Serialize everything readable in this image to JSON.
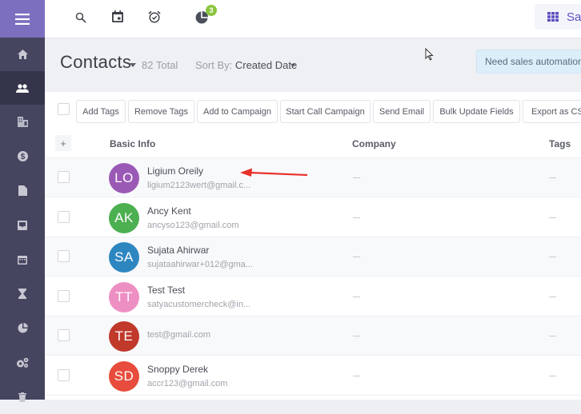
{
  "sidebar": {
    "menu_icon": "hamburger-menu-icon",
    "items": [
      {
        "name": "home",
        "icon": "home-icon",
        "active": false
      },
      {
        "name": "contacts",
        "icon": "contacts-icon",
        "active": true
      },
      {
        "name": "companies",
        "icon": "building-icon",
        "active": false
      },
      {
        "name": "deals",
        "icon": "dollar-icon",
        "active": false
      },
      {
        "name": "documents",
        "icon": "document-icon",
        "active": false
      },
      {
        "name": "inbox",
        "icon": "inbox-icon",
        "active": false
      },
      {
        "name": "calendar",
        "icon": "calendar-icon",
        "active": false
      },
      {
        "name": "tasks",
        "icon": "hourglass-icon",
        "active": false
      },
      {
        "name": "reports",
        "icon": "pie-chart-icon",
        "active": false
      },
      {
        "name": "settings",
        "icon": "gears-icon",
        "active": false
      },
      {
        "name": "trash",
        "icon": "trash-icon",
        "active": false
      }
    ]
  },
  "topbar": {
    "icons": [
      "search-icon",
      "calendar-icon",
      "alarm-clock-icon",
      "pie-chart-icon"
    ],
    "notification_badge": "3",
    "sales_button_label": "Sa"
  },
  "header": {
    "title": "Contacts",
    "total": "82 Total",
    "sort_label": "Sort By: ",
    "sort_value": "Created Date",
    "notice": "Need sales automation ?"
  },
  "toolbar": {
    "buttons": [
      "Add Tags",
      "Remove Tags",
      "Add to Campaign",
      "Start Call Campaign",
      "Send Email",
      "Bulk Update Fields",
      "Export as CSV"
    ]
  },
  "table": {
    "columns": [
      "Basic Info",
      "Company",
      "Tags"
    ],
    "rows": [
      {
        "initials": "LO",
        "name": "Ligium Oreily",
        "email": "ligium2123wert@gmail.c...",
        "company": "—",
        "tags": "—",
        "color": "#9b59b6"
      },
      {
        "initials": "AK",
        "name": "Ancy Kent",
        "email": "ancyso123@gmail.com",
        "company": "—",
        "tags": "—",
        "color": "#4caf50"
      },
      {
        "initials": "SA",
        "name": "Sujata Ahirwar",
        "email": "sujataahirwar+012@gma...",
        "company": "—",
        "tags": "—",
        "color": "#2e86c1"
      },
      {
        "initials": "TT",
        "name": "Test Test",
        "email": "satyacustomercheck@in...",
        "company": "—",
        "tags": "—",
        "color": "#ee8fc4"
      },
      {
        "initials": "TE",
        "name": "",
        "email": "test@gmail.com",
        "company": "—",
        "tags": "—",
        "color": "#c0392b"
      },
      {
        "initials": "SD",
        "name": "Snoppy Derek",
        "email": "accr123@gmail.com",
        "company": "—",
        "tags": "—",
        "color": "#e74c3c"
      }
    ]
  },
  "annotation": {
    "arrow_color": "#e8302a"
  }
}
